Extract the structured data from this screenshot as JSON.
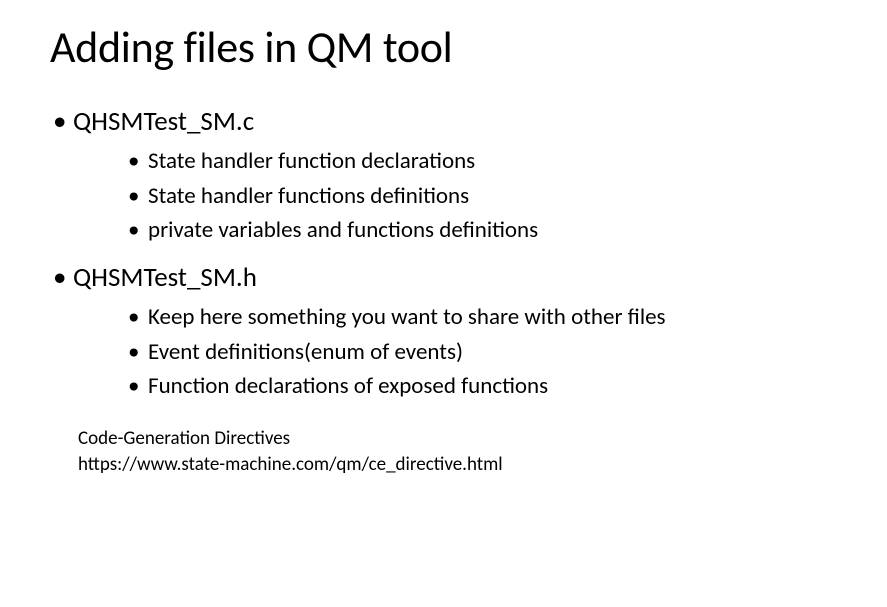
{
  "title": "Adding files in QM tool",
  "bullets": {
    "item1": {
      "label": "QHSMTest_SM.c",
      "sub1": "State handler function declarations",
      "sub2": "State handler functions definitions",
      "sub3": "private variables and functions definitions"
    },
    "item2": {
      "label": "QHSMTest_SM.h",
      "sub1": "Keep here something you want to share with other files",
      "sub2": "Event definitions(enum of events)",
      "sub3": "Function declarations of exposed functions"
    }
  },
  "footer": {
    "line1": "Code-Generation Directives",
    "line2": "https://www.state-machine.com/qm/ce_directive.html"
  }
}
